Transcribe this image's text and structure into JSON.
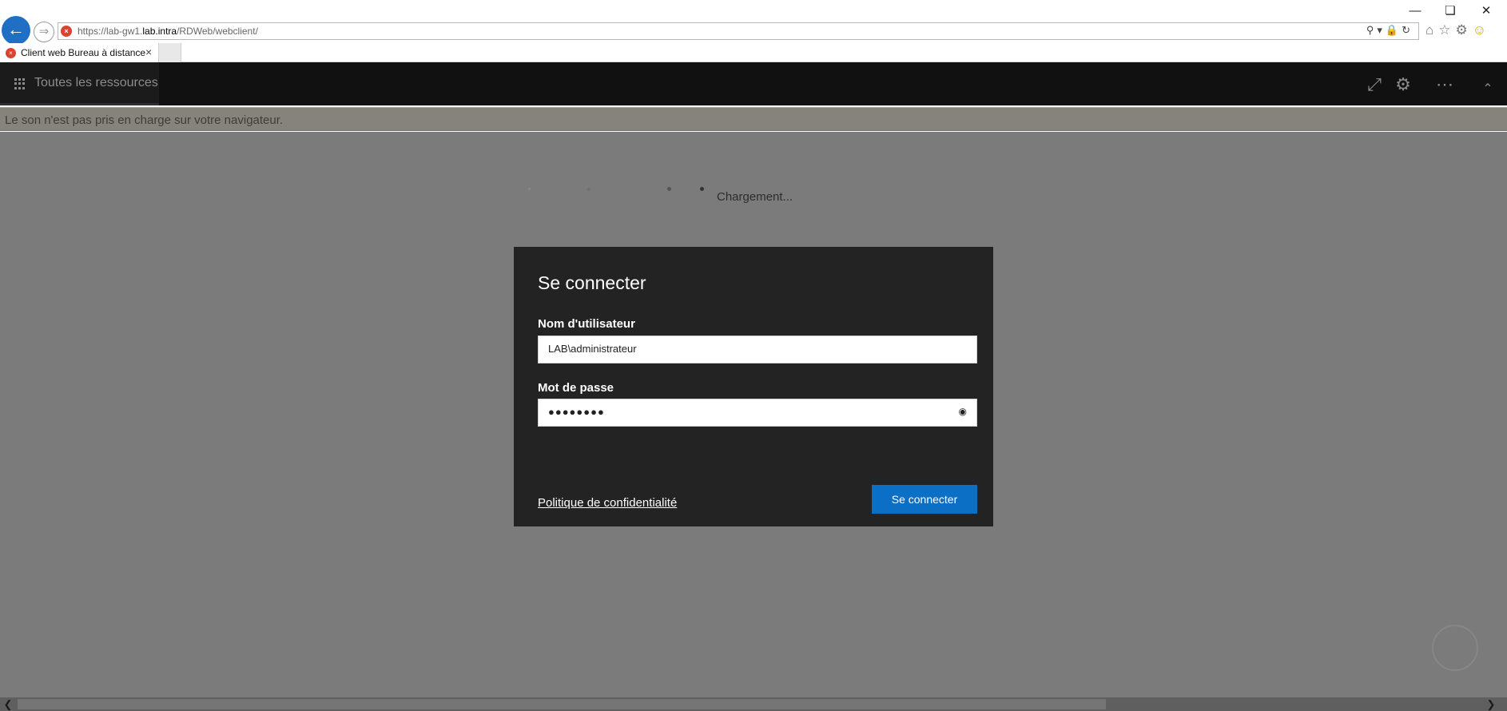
{
  "browser": {
    "url_prefix": "https://lab-gw1.",
    "url_host": "lab.intra",
    "url_path": "/RDWeb/webclient/",
    "tab_title": "Client web Bureau à distance",
    "back_icon": "back-arrow-icon",
    "forward_icon": "forward-arrow-icon"
  },
  "app": {
    "nav_label": "Toutes les ressources",
    "notice": "Le son n'est pas pris en charge sur votre navigateur.",
    "loading_text": "Chargement..."
  },
  "login": {
    "title": "Se connecter",
    "username_label": "Nom d'utilisateur",
    "username_value": "LAB\\administrateur",
    "password_label": "Mot de passe",
    "password_value": "●●●●●●●●",
    "privacy_link": "Politique de confidentialité",
    "submit_label": "Se connecter"
  },
  "colors": {
    "accent": "#0b6fc6",
    "header_bg": "#111111",
    "dialog_bg": "#232323",
    "overlay": "#7b7b7b"
  }
}
